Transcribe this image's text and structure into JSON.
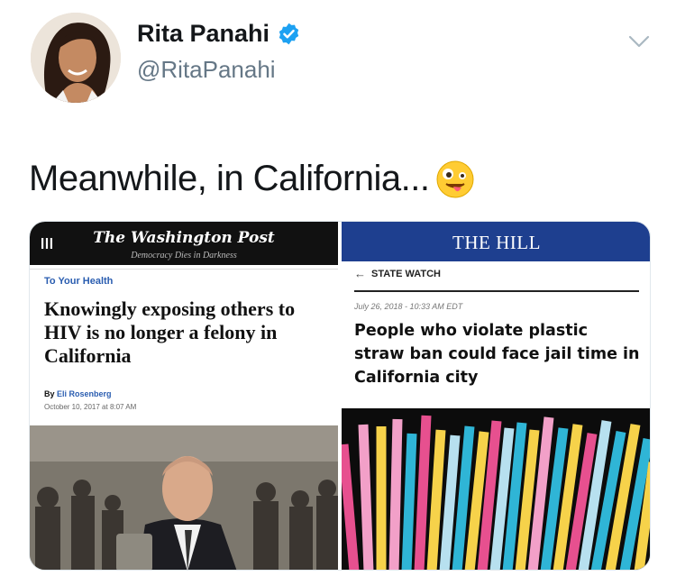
{
  "author": {
    "display_name": "Rita Panahi",
    "handle": "@RitaPanahi",
    "verified": true
  },
  "tweet": {
    "text": "Meanwhile, in California...",
    "emoji": "zany-face"
  },
  "media": {
    "left_card": {
      "publication": "The Washington Post",
      "tagline": "Democracy Dies in Darkness",
      "section": "To Your Health",
      "headline": "Knowingly exposing others to HIV is no longer a felony in California",
      "byline_prefix": "By",
      "author": "Eli Rosenberg",
      "date": "October 10, 2017 at 8:07 AM",
      "icon": "hamburger-menu"
    },
    "right_card": {
      "publication": "THE HILL",
      "section": "STATE WATCH",
      "date": "July 26, 2018 - 10:33 AM EDT",
      "headline": "People who violate plastic straw ban could face jail time in California city"
    }
  },
  "colors": {
    "verified_blue": "#1da1f2",
    "wapo_bar": "#111111",
    "hill_blue": "#1e3f8f",
    "link_blue": "#2a5db0"
  }
}
